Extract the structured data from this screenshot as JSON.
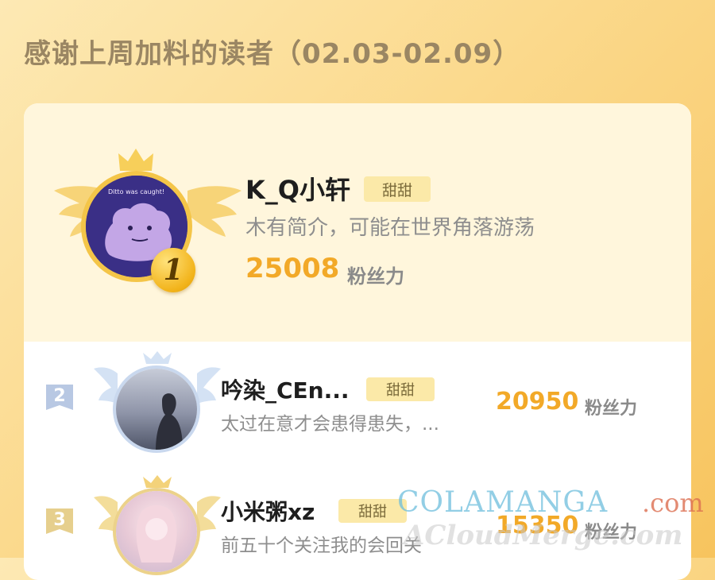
{
  "header": {
    "title": "感谢上周加料的读者（02.03-02.09）"
  },
  "colors": {
    "accent": "#f2a928",
    "tag_bg": "#fbe9a8",
    "bg_gold": "#f7c45e"
  },
  "readers": [
    {
      "rank": "1",
      "name": "K_Q小轩",
      "tag": "甜甜",
      "bio": "木有简介，可能在世界角落游荡",
      "score": "25008",
      "score_unit": "粉丝力",
      "avatar_caption": "Ditto was caught!"
    },
    {
      "rank": "2",
      "name": "吟染_CEn...",
      "tag": "甜甜",
      "bio": "太过在意才会患得患失，...",
      "score": "20950",
      "score_unit": "粉丝力"
    },
    {
      "rank": "3",
      "name": "小米粥xz",
      "tag": "甜甜",
      "bio": "前五十个关注我的会回关",
      "score": "15350",
      "score_unit": "粉丝力"
    }
  ],
  "watermark": {
    "line1": "COLAMANGA",
    "line1b": ".com",
    "line2": "ACloudMerge.com"
  }
}
